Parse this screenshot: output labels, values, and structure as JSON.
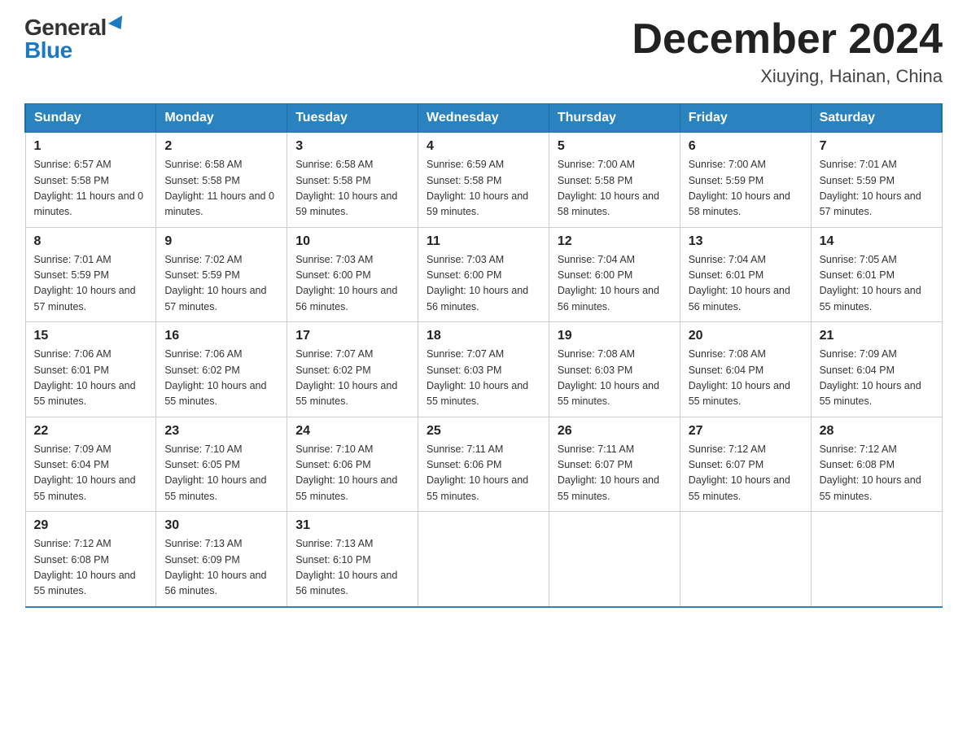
{
  "header": {
    "logo_general": "General",
    "logo_blue": "Blue",
    "month_title": "December 2024",
    "location": "Xiuying, Hainan, China"
  },
  "days_of_week": [
    "Sunday",
    "Monday",
    "Tuesday",
    "Wednesday",
    "Thursday",
    "Friday",
    "Saturday"
  ],
  "weeks": [
    [
      {
        "day": "1",
        "sunrise": "6:57 AM",
        "sunset": "5:58 PM",
        "daylight": "11 hours and 0 minutes."
      },
      {
        "day": "2",
        "sunrise": "6:58 AM",
        "sunset": "5:58 PM",
        "daylight": "11 hours and 0 minutes."
      },
      {
        "day": "3",
        "sunrise": "6:58 AM",
        "sunset": "5:58 PM",
        "daylight": "10 hours and 59 minutes."
      },
      {
        "day": "4",
        "sunrise": "6:59 AM",
        "sunset": "5:58 PM",
        "daylight": "10 hours and 59 minutes."
      },
      {
        "day": "5",
        "sunrise": "7:00 AM",
        "sunset": "5:58 PM",
        "daylight": "10 hours and 58 minutes."
      },
      {
        "day": "6",
        "sunrise": "7:00 AM",
        "sunset": "5:59 PM",
        "daylight": "10 hours and 58 minutes."
      },
      {
        "day": "7",
        "sunrise": "7:01 AM",
        "sunset": "5:59 PM",
        "daylight": "10 hours and 57 minutes."
      }
    ],
    [
      {
        "day": "8",
        "sunrise": "7:01 AM",
        "sunset": "5:59 PM",
        "daylight": "10 hours and 57 minutes."
      },
      {
        "day": "9",
        "sunrise": "7:02 AM",
        "sunset": "5:59 PM",
        "daylight": "10 hours and 57 minutes."
      },
      {
        "day": "10",
        "sunrise": "7:03 AM",
        "sunset": "6:00 PM",
        "daylight": "10 hours and 56 minutes."
      },
      {
        "day": "11",
        "sunrise": "7:03 AM",
        "sunset": "6:00 PM",
        "daylight": "10 hours and 56 minutes."
      },
      {
        "day": "12",
        "sunrise": "7:04 AM",
        "sunset": "6:00 PM",
        "daylight": "10 hours and 56 minutes."
      },
      {
        "day": "13",
        "sunrise": "7:04 AM",
        "sunset": "6:01 PM",
        "daylight": "10 hours and 56 minutes."
      },
      {
        "day": "14",
        "sunrise": "7:05 AM",
        "sunset": "6:01 PM",
        "daylight": "10 hours and 55 minutes."
      }
    ],
    [
      {
        "day": "15",
        "sunrise": "7:06 AM",
        "sunset": "6:01 PM",
        "daylight": "10 hours and 55 minutes."
      },
      {
        "day": "16",
        "sunrise": "7:06 AM",
        "sunset": "6:02 PM",
        "daylight": "10 hours and 55 minutes."
      },
      {
        "day": "17",
        "sunrise": "7:07 AM",
        "sunset": "6:02 PM",
        "daylight": "10 hours and 55 minutes."
      },
      {
        "day": "18",
        "sunrise": "7:07 AM",
        "sunset": "6:03 PM",
        "daylight": "10 hours and 55 minutes."
      },
      {
        "day": "19",
        "sunrise": "7:08 AM",
        "sunset": "6:03 PM",
        "daylight": "10 hours and 55 minutes."
      },
      {
        "day": "20",
        "sunrise": "7:08 AM",
        "sunset": "6:04 PM",
        "daylight": "10 hours and 55 minutes."
      },
      {
        "day": "21",
        "sunrise": "7:09 AM",
        "sunset": "6:04 PM",
        "daylight": "10 hours and 55 minutes."
      }
    ],
    [
      {
        "day": "22",
        "sunrise": "7:09 AM",
        "sunset": "6:04 PM",
        "daylight": "10 hours and 55 minutes."
      },
      {
        "day": "23",
        "sunrise": "7:10 AM",
        "sunset": "6:05 PM",
        "daylight": "10 hours and 55 minutes."
      },
      {
        "day": "24",
        "sunrise": "7:10 AM",
        "sunset": "6:06 PM",
        "daylight": "10 hours and 55 minutes."
      },
      {
        "day": "25",
        "sunrise": "7:11 AM",
        "sunset": "6:06 PM",
        "daylight": "10 hours and 55 minutes."
      },
      {
        "day": "26",
        "sunrise": "7:11 AM",
        "sunset": "6:07 PM",
        "daylight": "10 hours and 55 minutes."
      },
      {
        "day": "27",
        "sunrise": "7:12 AM",
        "sunset": "6:07 PM",
        "daylight": "10 hours and 55 minutes."
      },
      {
        "day": "28",
        "sunrise": "7:12 AM",
        "sunset": "6:08 PM",
        "daylight": "10 hours and 55 minutes."
      }
    ],
    [
      {
        "day": "29",
        "sunrise": "7:12 AM",
        "sunset": "6:08 PM",
        "daylight": "10 hours and 55 minutes."
      },
      {
        "day": "30",
        "sunrise": "7:13 AM",
        "sunset": "6:09 PM",
        "daylight": "10 hours and 56 minutes."
      },
      {
        "day": "31",
        "sunrise": "7:13 AM",
        "sunset": "6:10 PM",
        "daylight": "10 hours and 56 minutes."
      },
      null,
      null,
      null,
      null
    ]
  ],
  "labels": {
    "sunrise": "Sunrise:",
    "sunset": "Sunset:",
    "daylight": "Daylight:"
  }
}
